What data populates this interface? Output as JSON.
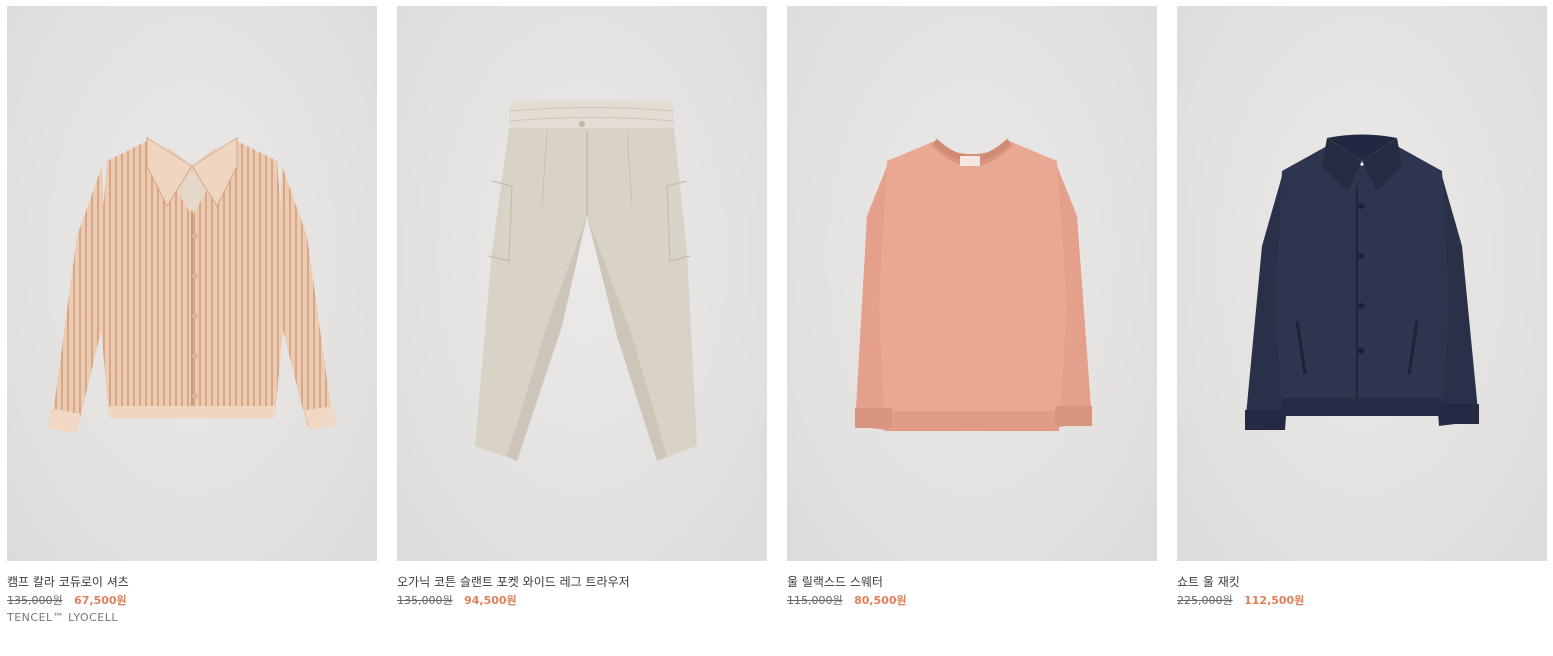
{
  "products": [
    {
      "name": "캠프 칼라 코듀로이 셔츠",
      "old_price": "135,000원",
      "sale_price": "67,500원",
      "tag": "TENCEL™ LYOCELL",
      "image": "shirt-image"
    },
    {
      "name": "오가닉 코튼 슬랜트 포켓 와이드 레그 트라우저",
      "old_price": "135,000원",
      "sale_price": "94,500원",
      "tag": "",
      "image": "trousers-image"
    },
    {
      "name": "울 릴랙스드 스웨터",
      "old_price": "115,000원",
      "sale_price": "80,500원",
      "tag": "",
      "image": "sweater-image"
    },
    {
      "name": "쇼트 울 재킷",
      "old_price": "225,000원",
      "sale_price": "112,500원",
      "tag": "",
      "image": "jacket-image"
    }
  ],
  "colors": {
    "sale": "#e0805a",
    "shirt": "#e6c3a8",
    "trousers": "#d9d2c8",
    "sweater": "#e8a590",
    "jacket": "#2a3048"
  }
}
